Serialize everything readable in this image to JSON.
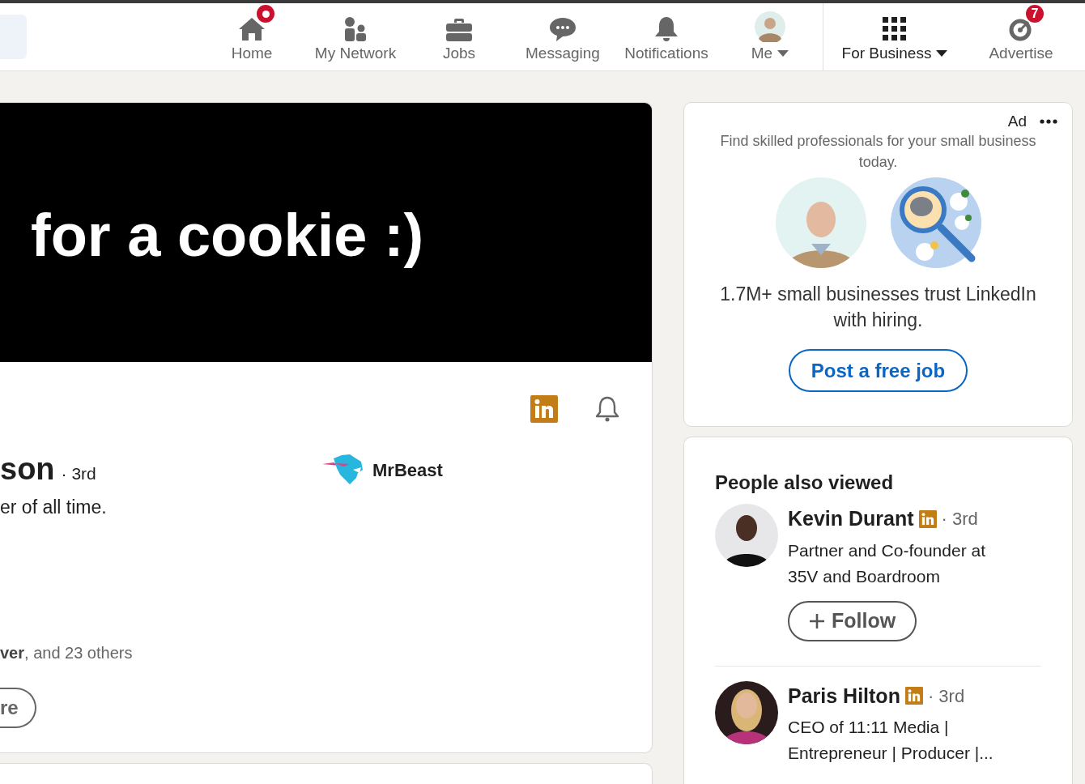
{
  "nav": {
    "items": [
      {
        "label": "Home",
        "kind": "home",
        "badge": {
          "kind": "dot"
        }
      },
      {
        "label": "My Network",
        "kind": "network"
      },
      {
        "label": "Jobs",
        "kind": "jobs"
      },
      {
        "label": "Messaging",
        "kind": "messaging"
      },
      {
        "label": "Notifications",
        "kind": "notifications"
      },
      {
        "label": "Me",
        "kind": "me",
        "dropdown": true
      }
    ],
    "business_items": [
      {
        "label": "For Business",
        "kind": "grid",
        "dropdown": true
      },
      {
        "label": "Advertise",
        "kind": "advertise",
        "badge": {
          "kind": "count",
          "text": "7"
        }
      }
    ]
  },
  "profile": {
    "banner_text": "for a cookie :)",
    "name": "son",
    "degree": "· 3rd",
    "company": "MrBeast",
    "headline": "er of all time.",
    "mutual": "**ver**, and 23 others",
    "button": "re"
  },
  "ad": {
    "label": "Ad",
    "text": "Find skilled professionals for your small business today.",
    "tagline": "1.7M+ small businesses trust LinkedIn with hiring.",
    "button": "Post a free job"
  },
  "people_also_viewed": {
    "title": "People also viewed",
    "people": [
      {
        "name": "Kevin Durant",
        "degree": "· 3rd",
        "headline": "Partner and Co-founder at 35V and Boardroom",
        "button": "Follow"
      },
      {
        "name": "Paris Hilton",
        "degree": "· 3rd",
        "headline": "CEO of 11:11 Media | Entrepreneur | Producer |..."
      }
    ]
  }
}
